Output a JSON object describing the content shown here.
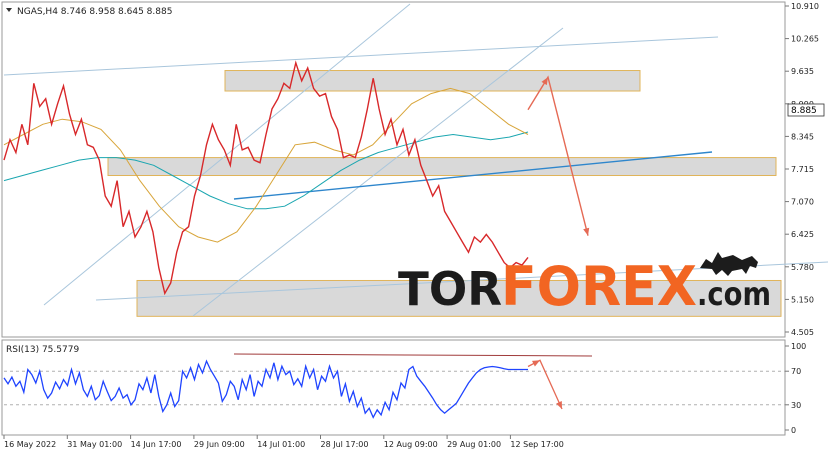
{
  "chart_data": [
    {
      "type": "line",
      "title": "NGAS,H4 8.746 8.958 8.645 8.885",
      "x_tick_labels": [
        "16 May 2022",
        "31 May 01:00",
        "14 Jun 17:00",
        "29 Jun 09:00",
        "14 Jul 01:00",
        "28 Jul 17:00",
        "12 Aug 09:00",
        "29 Aug 01:00",
        "12 Sep 17:00"
      ],
      "y_tick_labels": [
        "10.910",
        "10.265",
        "9.635",
        "8.990",
        "8.345",
        "7.715",
        "7.070",
        "6.425",
        "5.780",
        "5.150",
        "4.505"
      ],
      "ylim": [
        4.505,
        10.91
      ],
      "current_price_label": "8.885",
      "price_x": [
        0,
        3,
        6,
        9,
        12,
        15,
        18,
        21,
        24,
        27,
        30,
        33,
        36,
        39,
        42,
        45,
        48,
        51,
        54,
        57,
        60,
        63,
        66,
        69,
        72,
        75,
        78,
        81,
        84,
        87,
        90,
        93,
        96,
        99,
        102,
        105,
        108,
        111,
        114,
        117,
        120,
        123,
        126,
        129,
        132,
        135,
        138,
        141,
        144,
        147,
        150,
        153,
        156,
        159,
        162,
        165,
        168,
        171,
        174,
        177,
        180,
        183,
        186,
        189,
        192,
        195,
        198,
        201,
        204,
        207,
        210,
        213,
        216,
        219,
        222,
        225,
        228,
        231,
        234,
        237,
        240,
        243,
        246,
        249,
        252,
        255,
        258,
        261,
        264
      ],
      "price_y": [
        7.9,
        8.3,
        8.05,
        8.6,
        8.2,
        9.4,
        8.95,
        9.1,
        8.6,
        9.0,
        9.35,
        8.8,
        8.4,
        8.7,
        8.2,
        8.15,
        7.9,
        7.2,
        7.0,
        7.5,
        6.6,
        6.9,
        6.4,
        6.6,
        6.9,
        6.5,
        5.8,
        5.3,
        5.5,
        6.1,
        6.5,
        6.6,
        7.2,
        7.6,
        8.2,
        8.6,
        8.3,
        8.1,
        7.8,
        8.6,
        8.1,
        8.15,
        7.9,
        7.85,
        8.4,
        8.9,
        9.1,
        9.4,
        9.3,
        9.8,
        9.45,
        9.7,
        9.3,
        9.15,
        9.2,
        8.75,
        8.5,
        7.95,
        8.0,
        7.95,
        8.35,
        8.885,
        9.5,
        8.9,
        8.4,
        8.7,
        8.2,
        8.5,
        8.0,
        8.3,
        7.8,
        7.5,
        7.2,
        7.4,
        6.9,
        6.7,
        6.5,
        6.3,
        6.1,
        6.4,
        6.3,
        6.45,
        6.3,
        6.1,
        5.9,
        5.8,
        5.9,
        5.85,
        6.0
      ],
      "forecast_y": [
        8.885,
        9.52,
        6.425
      ],
      "ma_slow_y": [
        7.5,
        7.6,
        7.7,
        7.8,
        7.9,
        7.95,
        7.95,
        7.9,
        7.8,
        7.6,
        7.4,
        7.2,
        7.05,
        6.95,
        6.95,
        7.0,
        7.2,
        7.45,
        7.7,
        7.9,
        8.05,
        8.15,
        8.25,
        8.35,
        8.4,
        8.35,
        8.3,
        8.35,
        8.45
      ],
      "ma_fast_y": [
        8.2,
        8.4,
        8.6,
        8.7,
        8.65,
        8.5,
        8.1,
        7.5,
        7.0,
        6.6,
        6.4,
        6.3,
        6.5,
        7.0,
        7.6,
        8.2,
        8.25,
        8.1,
        8.0,
        8.2,
        8.6,
        9.0,
        9.2,
        9.3,
        9.2,
        8.9,
        8.6,
        8.4
      ],
      "zones": [
        [
          9.25,
          9.65
        ],
        [
          7.6,
          7.95
        ],
        [
          4.85,
          5.55
        ]
      ]
    },
    {
      "type": "line",
      "title": "RSI(13) 75.5779",
      "y_tick_labels": [
        "100",
        "70",
        "30",
        "0"
      ],
      "ylim": [
        0,
        100
      ],
      "levels": [
        70,
        30
      ],
      "rsi_x": [
        0,
        4,
        8,
        12,
        16,
        20,
        24,
        28,
        32,
        36,
        40,
        44,
        48,
        52,
        56,
        60,
        64,
        68,
        72,
        76,
        80,
        84,
        88,
        92,
        96,
        100,
        104,
        108,
        112,
        116,
        120,
        124,
        128,
        132,
        136,
        140,
        144,
        148,
        152,
        156,
        160,
        164,
        168,
        172,
        176,
        180,
        184,
        188,
        192,
        196,
        200,
        204,
        208,
        212,
        216,
        220,
        224,
        228,
        232,
        236,
        240,
        244,
        248,
        252,
        256,
        260,
        264,
        268,
        272,
        276,
        280,
        284,
        288,
        292,
        296,
        300,
        304,
        308,
        312,
        316,
        320,
        324,
        328,
        332,
        336,
        340,
        344,
        348,
        352,
        356,
        360,
        364,
        368,
        372,
        376,
        380,
        384,
        388,
        392,
        396,
        400,
        404,
        408,
        412,
        416,
        420,
        424,
        428,
        432,
        436,
        440,
        444,
        448,
        452,
        456,
        460,
        464,
        468,
        472,
        476,
        480,
        484,
        488,
        492,
        496,
        500,
        504,
        508,
        512,
        516,
        520,
        524,
        528
      ],
      "rsi_y": [
        62,
        55,
        63,
        52,
        58,
        45,
        72,
        66,
        56,
        70,
        48,
        38,
        44,
        57,
        49,
        60,
        53,
        72,
        55,
        68,
        48,
        40,
        52,
        36,
        41,
        58,
        46,
        35,
        40,
        50,
        38,
        42,
        30,
        36,
        55,
        48,
        62,
        44,
        66,
        40,
        22,
        30,
        44,
        28,
        35,
        70,
        62,
        74,
        60,
        78,
        68,
        82,
        72,
        64,
        56,
        34,
        42,
        58,
        52,
        36,
        60,
        48,
        66,
        40,
        58,
        52,
        72,
        62,
        80,
        60,
        76,
        66,
        70,
        54,
        61,
        52,
        76,
        62,
        72,
        48,
        64,
        58,
        76,
        62,
        70,
        40,
        55,
        34,
        46,
        28,
        38,
        20,
        26,
        15,
        24,
        18,
        33,
        24,
        45,
        36,
        56,
        50,
        72,
        75.5779,
        64,
        58,
        52,
        45,
        38,
        30,
        24,
        20,
        24,
        28,
        32,
        40,
        48,
        56,
        62,
        68,
        72,
        74,
        75,
        75.5779,
        75,
        74,
        73,
        72,
        72,
        72,
        72,
        72,
        72
      ],
      "forecast_y": [
        75.5779,
        83,
        25
      ]
    }
  ],
  "brand": {
    "logo_text_1": "TOR",
    "logo_text_2": "FOREX",
    "logo_text_3": ".com"
  },
  "colors": {
    "price": "#d8282a",
    "rsi": "#1f44ff",
    "ma_fast": "#d8a53a",
    "ma_slow": "#1aa6b0",
    "channel": "#a9c6dc",
    "support": "#2e86cc",
    "zone_fill": "#d9d9d9",
    "zone_border": "#e0b45a",
    "forecast": "#e56a55",
    "brand_dark": "#1c1c1c",
    "brand_orange": "#f26522"
  }
}
